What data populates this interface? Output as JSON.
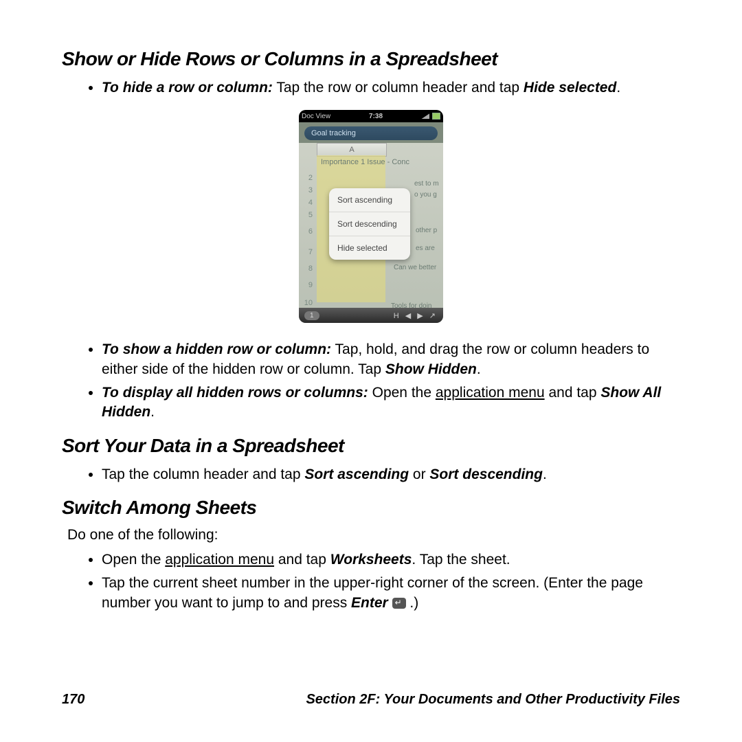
{
  "section1": {
    "title": "Show or Hide Rows or Columns in a Spreadsheet",
    "bullet1_lead": "To hide a row or column:",
    "bullet1_rest": " Tap the row or column header and tap ",
    "bullet1_term": "Hide selected",
    "bullet2_lead": "To show a hidden row or column:",
    "bullet2_rest": " Tap, hold, and drag the row or column headers to either side of the hidden row or column. Tap ",
    "bullet2_term": "Show Hidden",
    "bullet3_lead": "To display all hidden rows or columns:",
    "bullet3_rest1": " Open the ",
    "bullet3_link": "application menu",
    "bullet3_rest2": " and tap ",
    "bullet3_term": "Show All Hidden"
  },
  "section2": {
    "title": "Sort Your Data in a Spreadsheet",
    "bullet1_pre": "Tap the column header and tap ",
    "bullet1_t1": "Sort ascending",
    "bullet1_mid": " or ",
    "bullet1_t2": "Sort descending"
  },
  "section3": {
    "title": "Switch Among Sheets",
    "intro": "Do one of the following:",
    "b1_pre": "Open the ",
    "b1_link": "application menu",
    "b1_mid": " and tap ",
    "b1_term": "Worksheets",
    "b1_post": ". Tap the sheet.",
    "b2_pre": "Tap the current sheet number in the upper-right corner of the screen. (Enter the page number you want to jump to and press ",
    "b2_term": "Enter",
    "b2_post": " .)"
  },
  "footer": {
    "page": "170",
    "label": "Section 2F: Your Documents and Other Productivity Files"
  },
  "phone": {
    "app": "Doc View",
    "time": "7:38",
    "tab": "Goal tracking",
    "colA": "A",
    "header_row": "Importance 1 Issue - Conc",
    "rows": [
      "2",
      "3",
      "4",
      "5",
      "6",
      "7",
      "8",
      "9",
      "10"
    ],
    "menu": {
      "i1": "Sort ascending",
      "i2": "Sort descending",
      "i3": "Hide selected"
    },
    "frag1": "est to m",
    "frag2": "o you g",
    "frag3": "other p",
    "frag4": "es are",
    "frag5": "Can we better",
    "frag6": "Tools for doin",
    "page_pill": "1"
  }
}
